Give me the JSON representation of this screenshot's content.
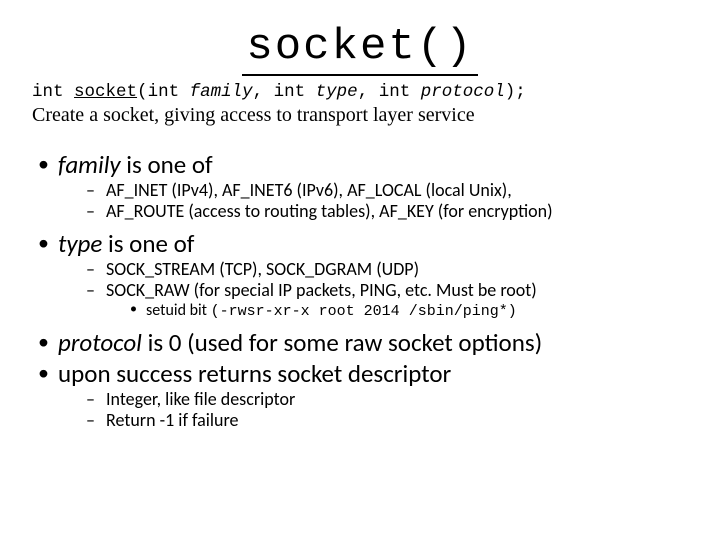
{
  "title": "socket()",
  "signature": {
    "ret": "int",
    "name": "socket",
    "open": "(",
    "p1t": "int",
    "p1n": "family",
    "p2t": "int",
    "p2n": "type",
    "p3t": "int",
    "p3n": "protocol",
    "sep": ",",
    "close": ");"
  },
  "description": "Create a socket, giving access to transport layer service",
  "bullets": [
    {
      "em": "family",
      "rest": "is one of",
      "sub": [
        "AF_INET (IPv4), AF_INET6 (IPv6), AF_LOCAL (local Unix),",
        "AF_ROUTE (access to routing tables), AF_KEY (for encryption)"
      ]
    },
    {
      "em": "type",
      "rest": "is one of",
      "sub": [
        "SOCK_STREAM (TCP), SOCK_DGRAM (UDP)",
        "SOCK_RAW (for special IP packets, PING, etc.  Must be root)"
      ],
      "sub3": {
        "label": "setuid bit ",
        "code": "(-rwsr-xr-x root 2014 /sbin/ping*)"
      }
    },
    {
      "em": "protocol",
      "rest": "is 0 (used for some raw socket options)"
    },
    {
      "text": "upon success returns socket descriptor",
      "sub": [
        "Integer, like file descriptor",
        "Return -1 if failure"
      ]
    }
  ]
}
